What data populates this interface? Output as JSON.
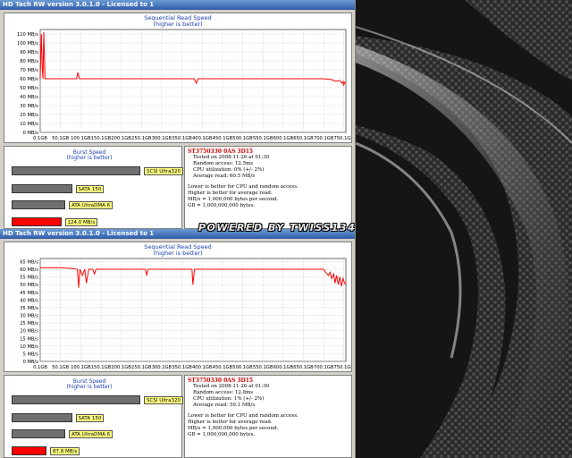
{
  "watermark": "POWERED BY TWISS134",
  "windows": [
    {
      "title": "HD Tach RW version 3.0.1.0 - Licensed to 1",
      "chart_data": {
        "type": "line",
        "title": "Sequential Read Speed",
        "subtitle": "(higher is better)",
        "y_ticks": [
          "0 MB/s",
          "10 MB/s",
          "20 MB/s",
          "30 MB/s",
          "40 MB/s",
          "50 MB/s",
          "60 MB/s",
          "70 MB/s",
          "80 MB/s",
          "90 MB/s",
          "100 MB/s",
          "110 MB/s"
        ],
        "x_ticks": [
          "0.1GB",
          "50.1GB",
          "100.1GB",
          "150.1GB",
          "200.1GB",
          "250.1GB",
          "300.1GB",
          "350.1GB",
          "400.1GB",
          "450.1GB",
          "500.1GB",
          "550.1GB",
          "600.1GB",
          "650.1GB",
          "700.1GB",
          "750.1GB"
        ],
        "ylim": [
          0,
          115
        ],
        "xlim": [
          0.1,
          755
        ],
        "series": [
          {
            "color": "#ff0000",
            "x": [
              0.1,
              3,
              5,
              7,
              9,
              12,
              20,
              40,
              60,
              85,
              90,
              93,
              97,
              110,
              150,
              200,
              250,
              300,
              350,
              380,
              386,
              390,
              400,
              450,
              500,
              550,
              600,
              650,
              700,
              720,
              730,
              740,
              745,
              748,
              750,
              752,
              755
            ],
            "y": [
              60,
              110,
              75,
              60,
              112,
              60,
              60,
              60,
              60,
              60,
              60,
              67,
              60,
              60,
              60,
              60,
              60,
              60,
              60,
              60,
              55,
              60,
              60,
              60,
              60,
              60,
              60,
              60,
              60,
              59,
              57,
              58,
              55,
              57,
              53,
              56,
              55
            ]
          }
        ]
      },
      "burst": {
        "title": "Burst Speed",
        "subtitle": "(higher is better)",
        "bars": [
          {
            "label": "SCSI Ultra320",
            "fraction": 0.96,
            "color": "#707070"
          },
          {
            "label": "SATA 150",
            "fraction": 0.45,
            "color": "#707070"
          },
          {
            "label": "ATA UltraDMA 6",
            "fraction": 0.4,
            "color": "#707070"
          },
          {
            "label": "124.0 MB/s",
            "fraction": 0.37,
            "color": "#ff0000"
          }
        ]
      },
      "info": {
        "drive": "ST3750330 0AS 3D15",
        "tested": "Tested on 2008-11-26 at 01:30",
        "random": "Random access: 12.5ms",
        "cpu": "CPU utilization: 0% (+/- 2%)",
        "avg": "Average read: 60.5 MB/s",
        "note1": "Lower is better for CPU and random access.",
        "note2": "Higher is better for average read.",
        "note3": "MB/s = 1,000,000 bytes per second.",
        "note4": "GB = 1,000,000,000 bytes."
      }
    },
    {
      "title": "HD Tach RW version 3.0.1.0 - Licensed to 1",
      "chart_data": {
        "type": "line",
        "title": "Sequential Read Speed",
        "subtitle": "(higher is better)",
        "y_ticks": [
          "0 MB/s",
          "5 MB/s",
          "10 MB/s",
          "15 MB/s",
          "20 MB/s",
          "25 MB/s",
          "30 MB/s",
          "35 MB/s",
          "40 MB/s",
          "45 MB/s",
          "50 MB/s",
          "55 MB/s",
          "60 MB/s",
          "65 MB/s"
        ],
        "x_ticks": [
          "0.1GB",
          "50.1GB",
          "100.1GB",
          "150.1GB",
          "200.1GB",
          "250.1GB",
          "300.1GB",
          "350.1GB",
          "400.1GB",
          "450.1GB",
          "500.1GB",
          "550.1GB",
          "600.1GB",
          "650.1GB",
          "700.1GB",
          "750.1GB"
        ],
        "ylim": [
          0,
          67
        ],
        "xlim": [
          0.1,
          755
        ],
        "series": [
          {
            "color": "#ff0000",
            "x": [
              0.1,
              20,
              50,
              80,
              92,
              95,
              98,
              104,
              110,
              114,
              120,
              130,
              134,
              138,
              145,
              200,
              260,
              263,
              266,
              300,
              375,
              377,
              381,
              386,
              400,
              500,
              600,
              650,
              700,
              705,
              712,
              716,
              720,
              725,
              728,
              732,
              736,
              740,
              744,
              748,
              752,
              755
            ],
            "y": [
              61,
              61,
              61,
              60.5,
              60,
              48,
              60,
              56,
              60,
              51,
              60,
              60,
              57,
              60,
              60,
              60,
              60,
              56,
              60,
              60,
              60,
              50,
              60,
              60,
              60,
              60,
              60,
              60,
              60,
              58,
              56,
              58,
              54,
              57,
              51,
              56,
              50,
              55,
              49,
              54,
              51,
              50
            ]
          }
        ]
      },
      "burst": {
        "title": "Burst Speed",
        "subtitle": "(higher is better)",
        "bars": [
          {
            "label": "SCSI Ultra320",
            "fraction": 0.96,
            "color": "#707070"
          },
          {
            "label": "SATA 150",
            "fraction": 0.45,
            "color": "#707070"
          },
          {
            "label": "ATA UltraDMA 6",
            "fraction": 0.4,
            "color": "#707070"
          },
          {
            "label": "87.8 MB/s",
            "fraction": 0.26,
            "color": "#ff0000"
          }
        ]
      },
      "info": {
        "drive": "ST3750330 0AS 3D15",
        "tested": "Tested on 2008-11-26 at 01:30",
        "random": "Random access: 12.8ms",
        "cpu": "CPU utilization: 1% (+/- 2%)",
        "avg": "Average read: 59.1 MB/s",
        "note1": "Lower is better for CPU and random access.",
        "note2": "Higher is better for average read.",
        "note3": "MB/s = 1,000,000 bytes per second.",
        "note4": "GB = 1,000,000,000 bytes."
      }
    }
  ]
}
